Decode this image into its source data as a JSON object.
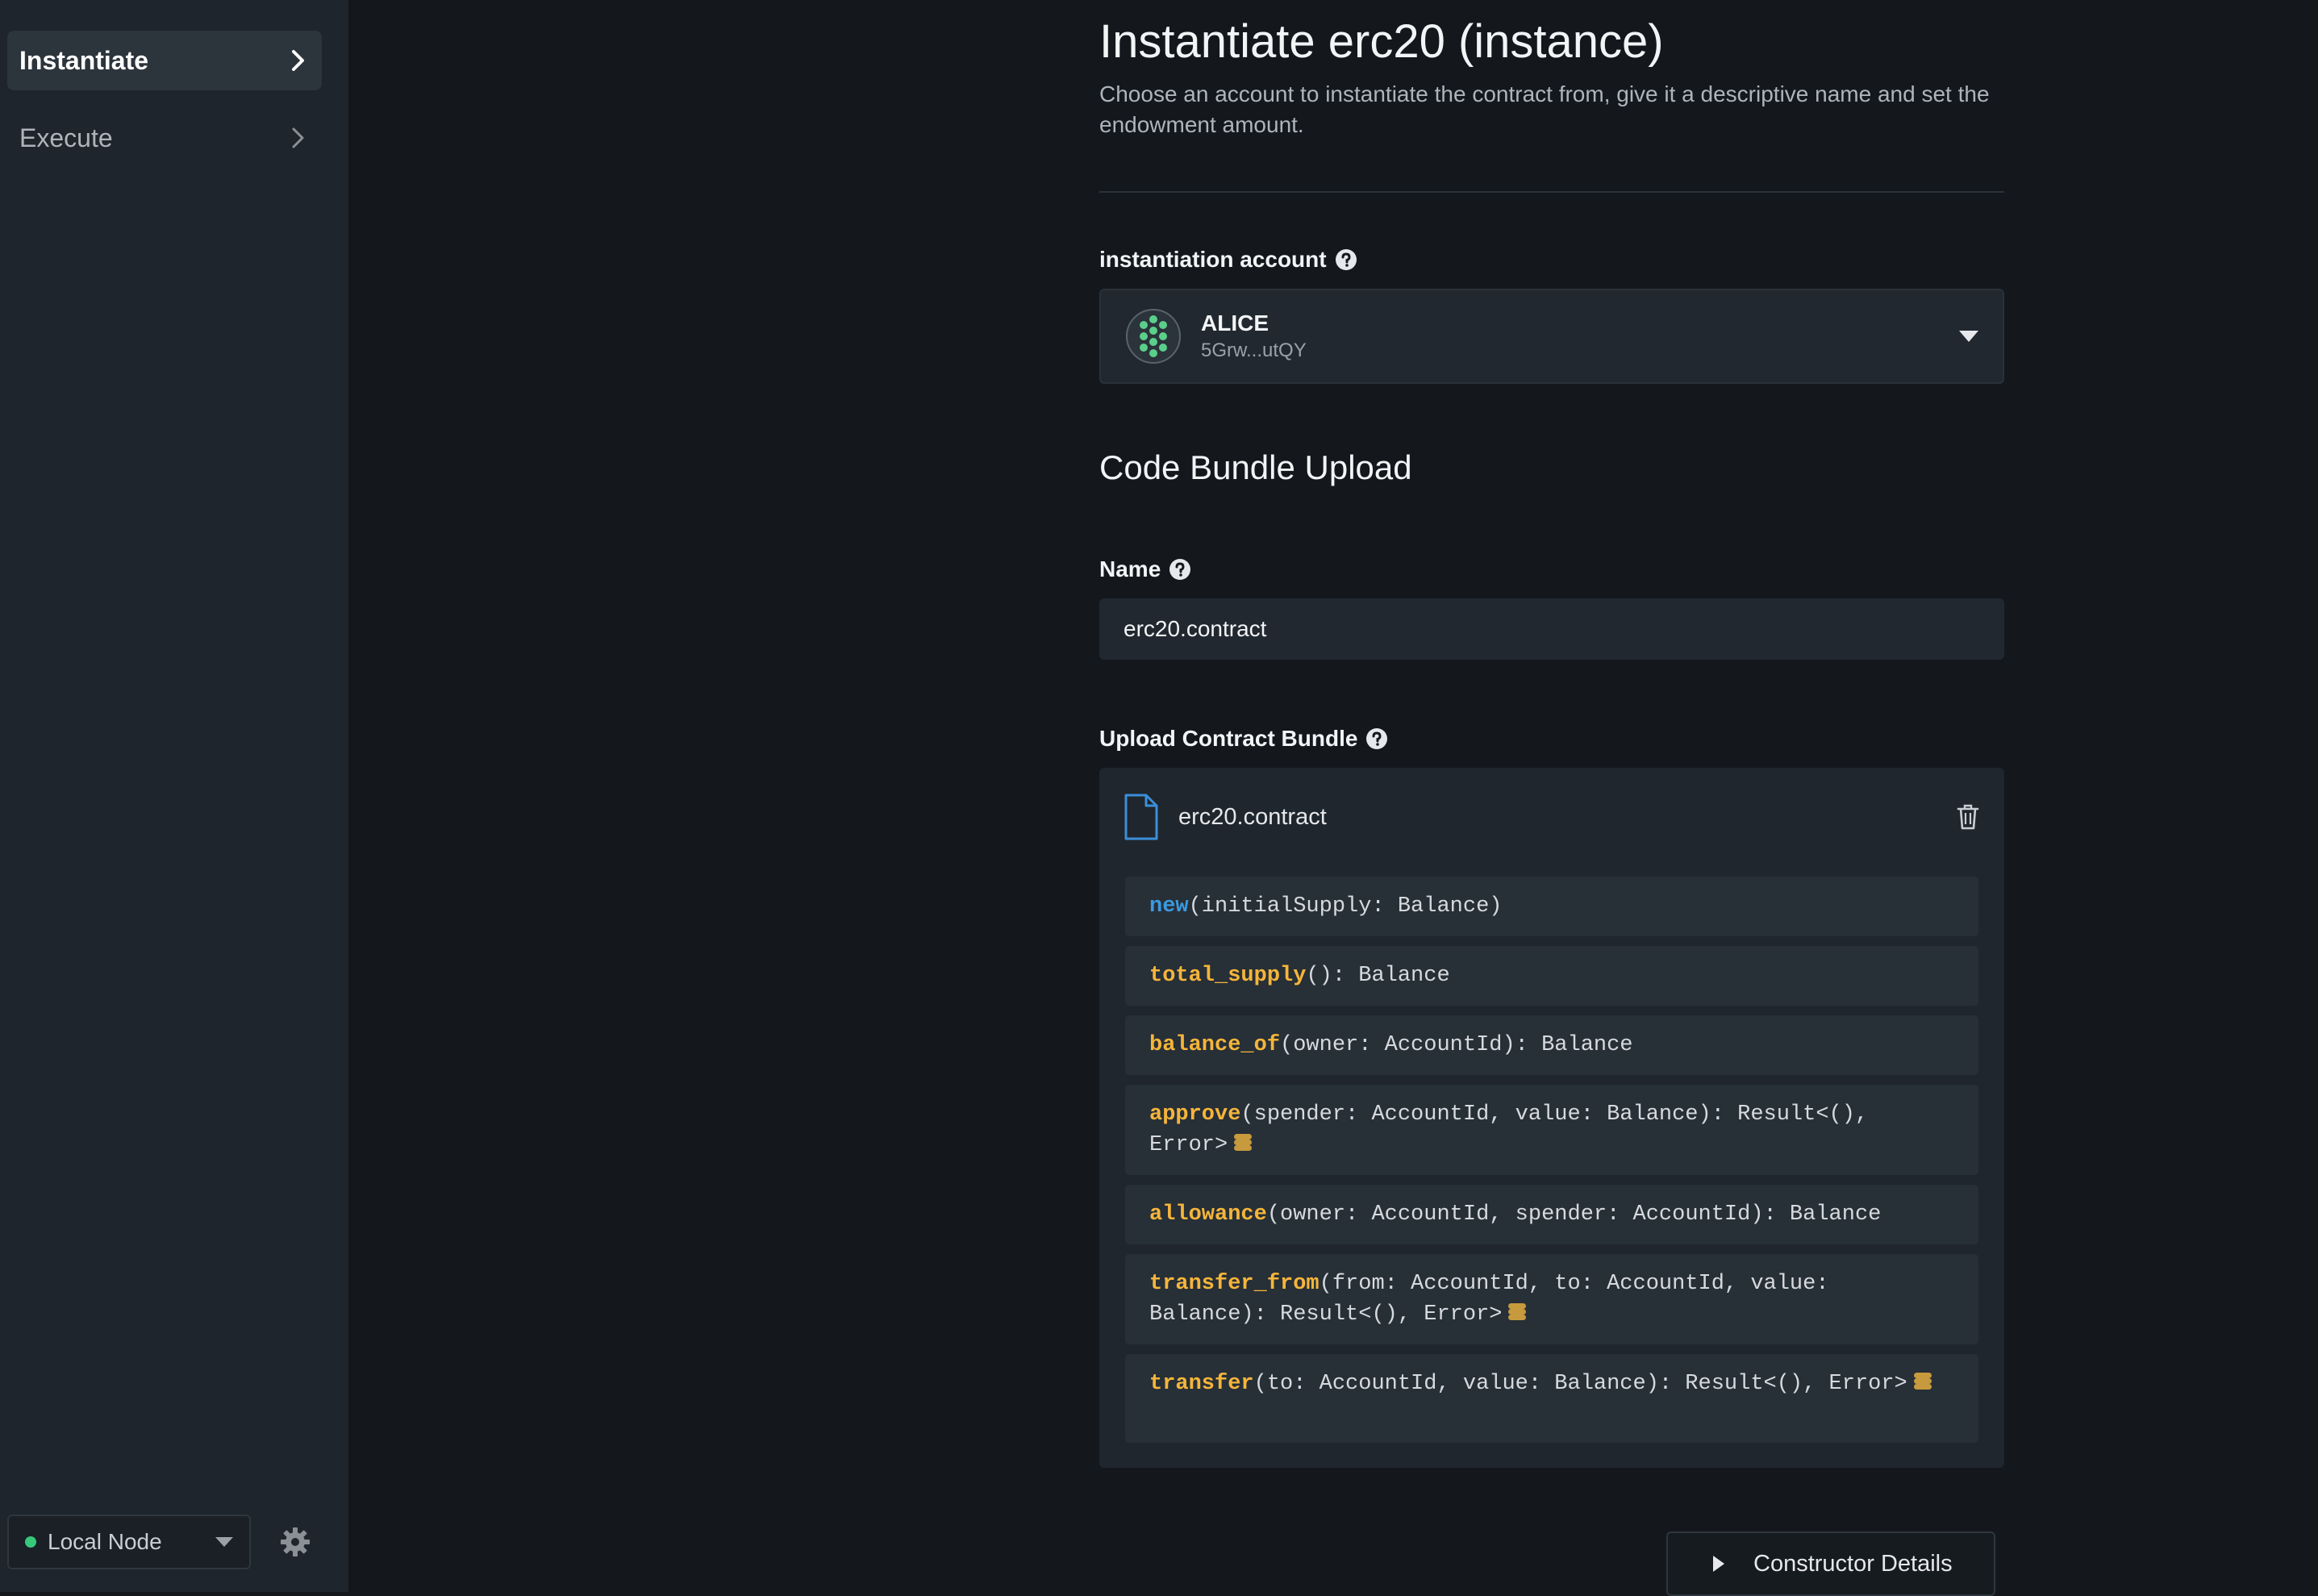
{
  "sidebar": {
    "items": [
      {
        "label": "Instantiate",
        "active": true
      },
      {
        "label": "Execute",
        "active": false
      }
    ],
    "node_selector": {
      "label": "Local Node",
      "status_color": "#37c87a"
    },
    "settings_icon": "gear-icon"
  },
  "main": {
    "title": "Instantiate erc20 (instance)",
    "subtitle": "Choose an account to instantiate the contract from, give it a descriptive name and set the endowment amount.",
    "account": {
      "label": "instantiation account",
      "name": "ALICE",
      "address": "5Grw...utQY"
    },
    "section_title": "Code Bundle Upload",
    "name_field": {
      "label": "Name",
      "value": "erc20.contract"
    },
    "bundle": {
      "label": "Upload Contract Bundle",
      "file_name": "erc20.contract",
      "messages": [
        {
          "name": "new",
          "signature": "(initialSupply: Balance)",
          "constructor": true,
          "payable": false
        },
        {
          "name": "total_supply",
          "signature": "(): Balance",
          "constructor": false,
          "payable": false
        },
        {
          "name": "balance_of",
          "signature": "(owner: AccountId): Balance",
          "constructor": false,
          "payable": false
        },
        {
          "name": "approve",
          "signature": "(spender: AccountId, value: Balance): Result<(), Error>",
          "constructor": false,
          "payable": true
        },
        {
          "name": "allowance",
          "signature": "(owner: AccountId, spender: AccountId): Balance",
          "constructor": false,
          "payable": false
        },
        {
          "name": "transfer_from",
          "signature": "(from: AccountId, to: AccountId, value: Balance): Result<(), Error>",
          "constructor": false,
          "payable": true
        },
        {
          "name": "transfer",
          "signature": "(to: AccountId, value: Balance): Result<(), Error>",
          "constructor": false,
          "payable": true
        }
      ]
    },
    "constructor_details_label": "Constructor Details"
  },
  "colors": {
    "accent_fn": "#f5b53a",
    "constructor_fn": "#3b9ae0",
    "background": "#14181d",
    "sidebar": "#1e252c"
  }
}
